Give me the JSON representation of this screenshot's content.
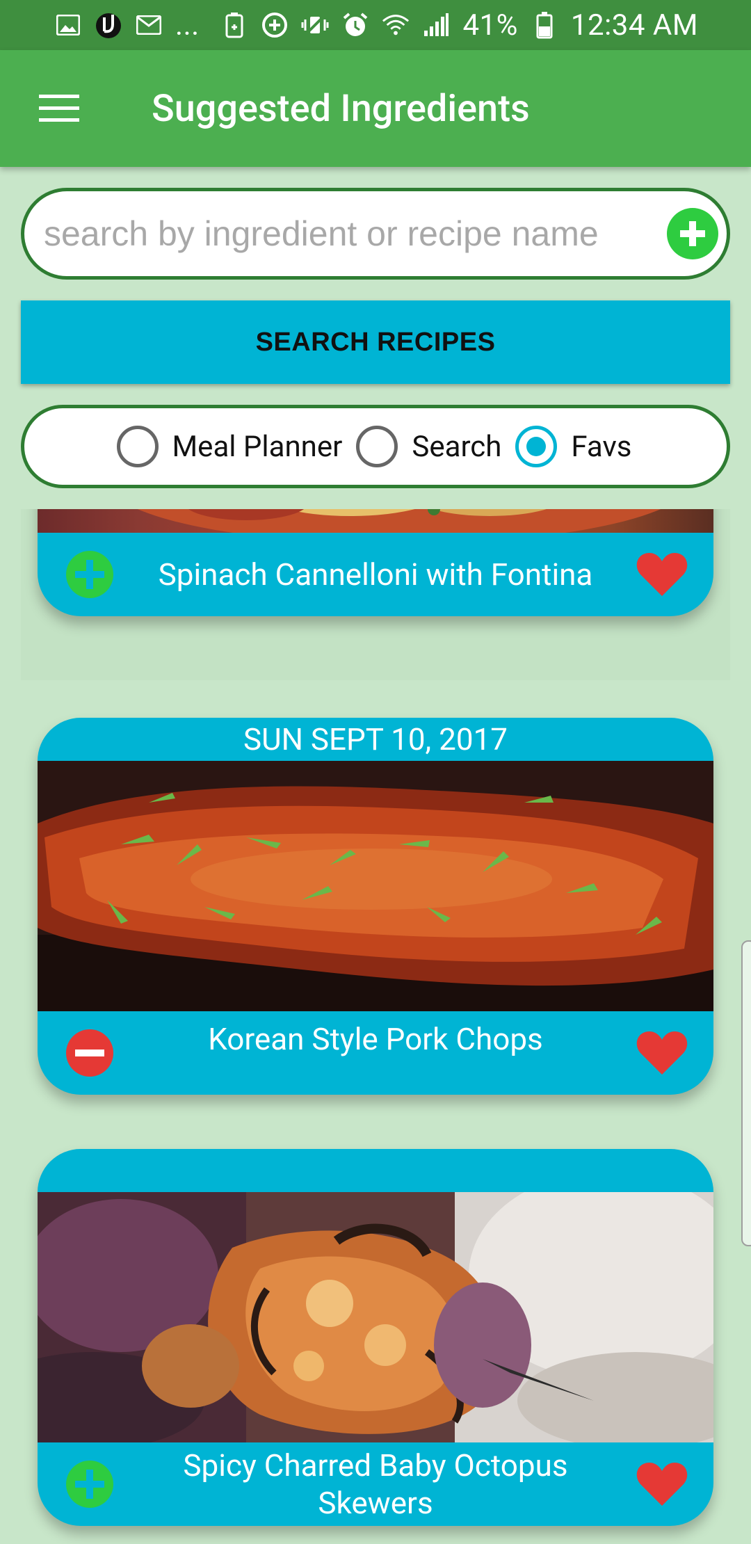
{
  "status_bar": {
    "dots": "...",
    "battery": "41%",
    "time": "12:34 AM"
  },
  "app_bar": {
    "title": "Suggested Ingredients",
    "menu_icon": "hamburger-menu-icon"
  },
  "search": {
    "placeholder": "search by ingredient or recipe name",
    "value": "",
    "add_icon": "plus-circle-icon"
  },
  "search_button": {
    "label": "SEARCH RECIPES"
  },
  "radio_group": {
    "options": [
      {
        "label": "Meal Planner",
        "checked": false
      },
      {
        "label": "Search",
        "checked": false
      },
      {
        "label": "Favs",
        "checked": true
      }
    ]
  },
  "recipes": [
    {
      "title": "Spinach Cannelloni with Fontina",
      "date": "",
      "left_action": "add-circle-icon",
      "favorite": true
    },
    {
      "title": "Korean Style Pork Chops",
      "date": "SUN SEPT 10, 2017",
      "left_action": "remove-circle-icon",
      "favorite": true
    },
    {
      "title": "Spicy Charred Baby Octopus Skewers",
      "date": "",
      "left_action": "add-circle-icon",
      "favorite": true
    }
  ],
  "colors": {
    "status_bar": "#3f8f3f",
    "app_bar": "#4caf50",
    "background": "#c8e6c9",
    "accent_cyan": "#00b4d4",
    "border_green": "#2e7d32",
    "add_green": "#2ecc40",
    "remove_red": "#e53935",
    "heart_red": "#e53935"
  }
}
